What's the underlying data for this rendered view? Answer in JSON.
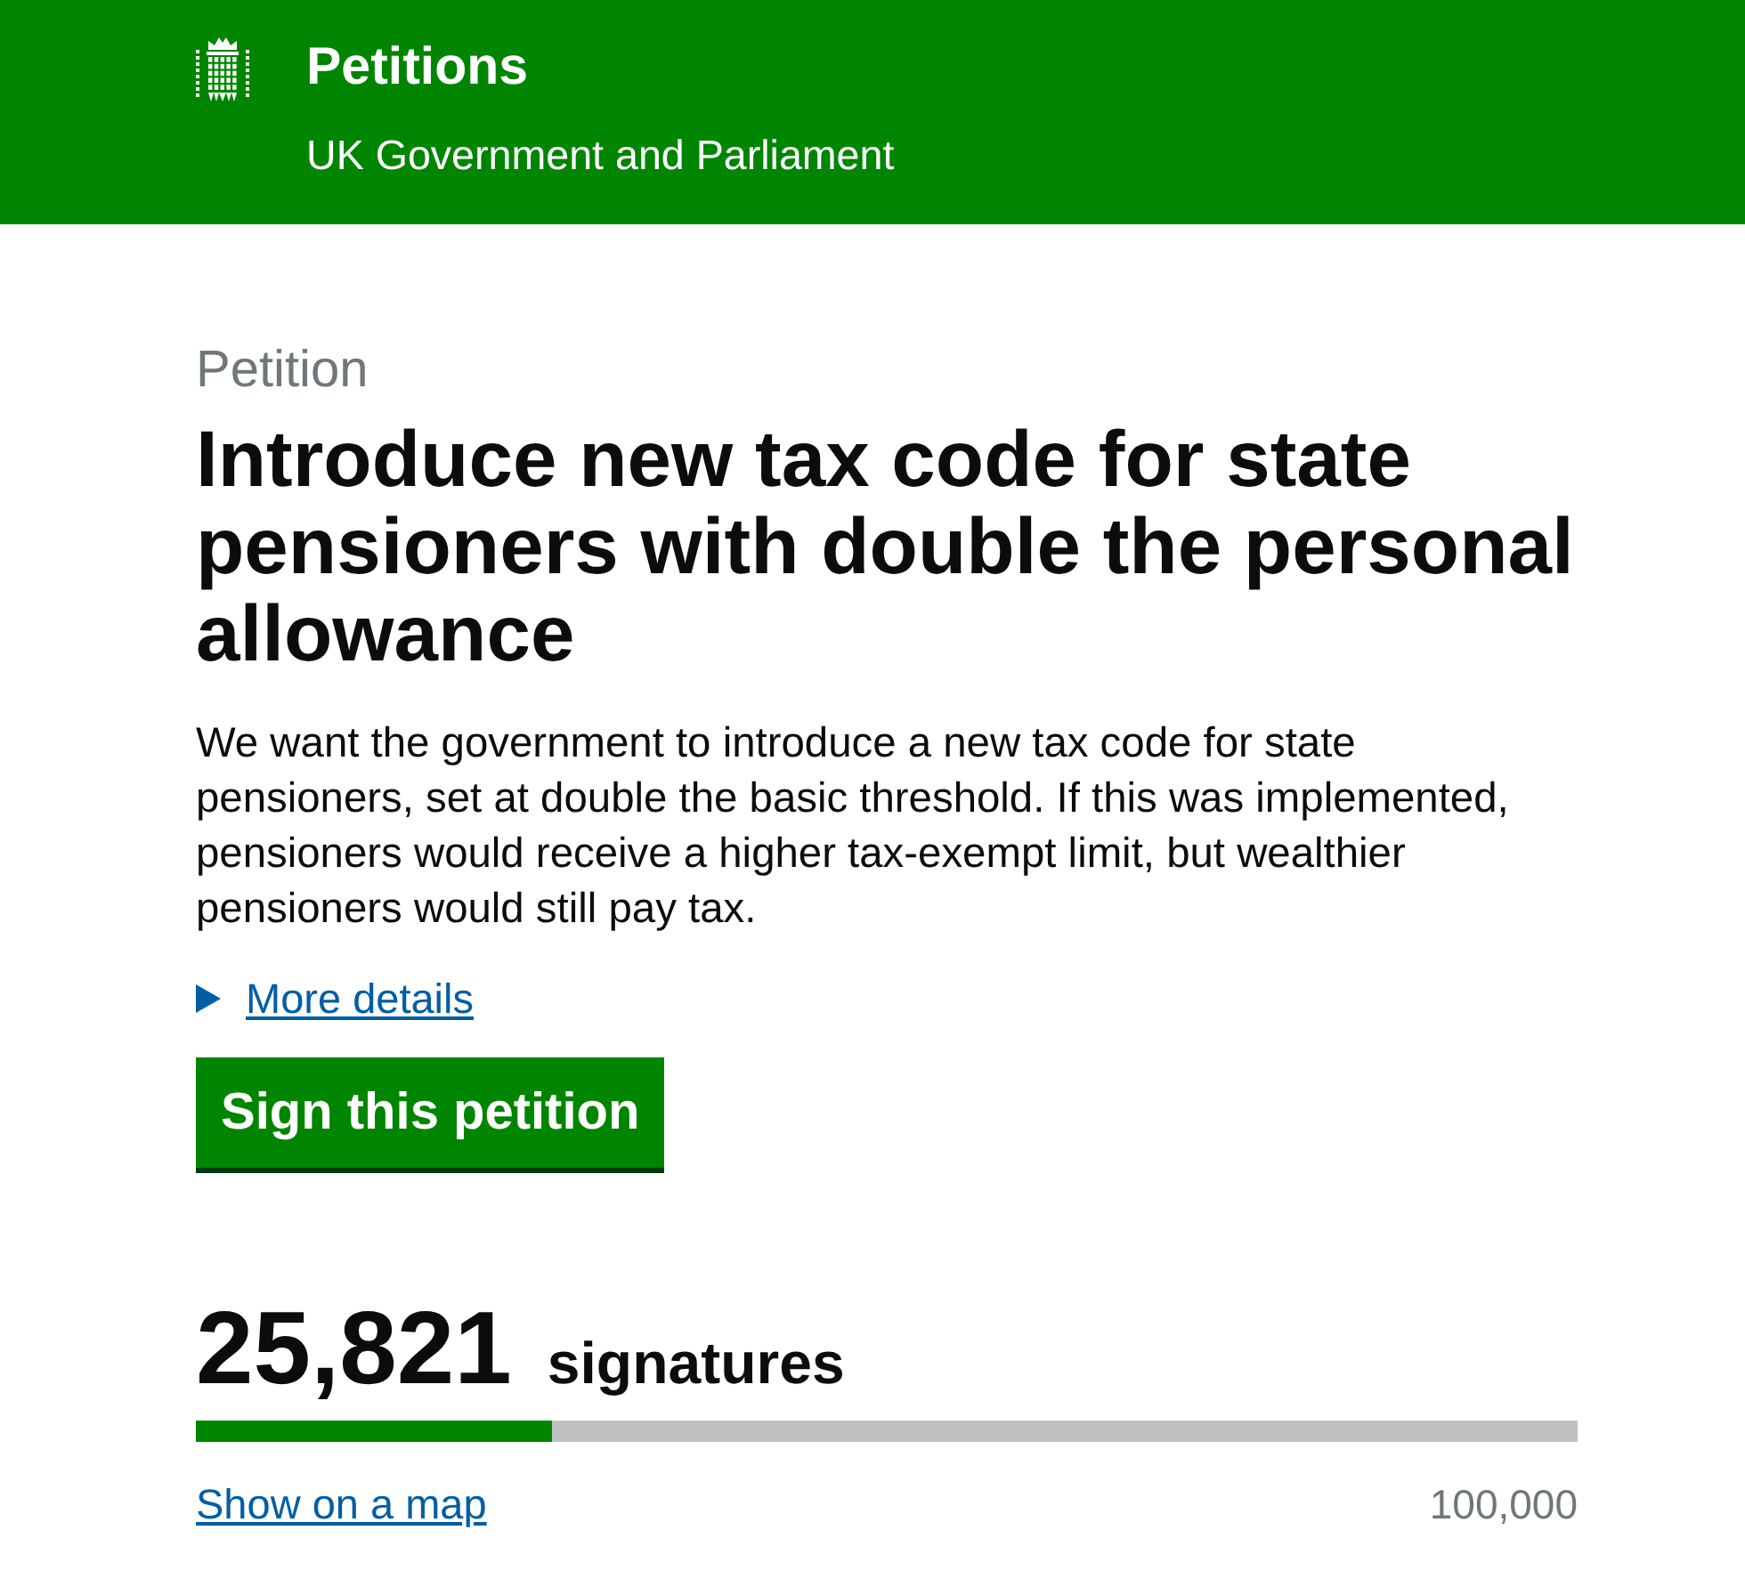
{
  "header": {
    "title": "Petitions",
    "subtitle": "UK Government and Parliament"
  },
  "petition": {
    "label": "Petition",
    "title": "Introduce new tax code for state pensioners with double the personal allowance",
    "summary": "We want the government to introduce a new tax code for state pensioners, set at double the basic threshold. If this was implemented, pensioners would receive a higher tax-exempt limit, but wealthier pensioners would still pay tax.",
    "details": {
      "label": "More details",
      "expanded": false
    },
    "sign_button": "Sign this petition"
  },
  "signatures": {
    "count": "25,821",
    "unit": "signatures",
    "level": 0.25821,
    "map_link": "Show on a map",
    "target": "100,000"
  }
}
